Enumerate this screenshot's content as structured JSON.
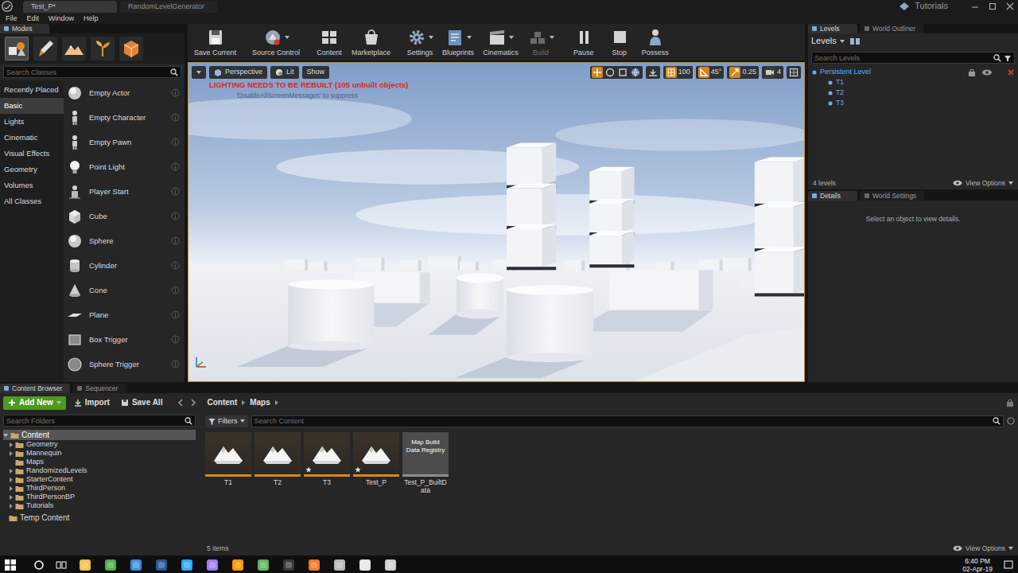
{
  "titlebar": {
    "tabs": [
      {
        "label": "Test_P*",
        "selected": true
      },
      {
        "label": "RandomLevelGenerator",
        "selected": false
      }
    ],
    "tutorials": "Tutorials"
  },
  "menu": [
    "File",
    "Edit",
    "Window",
    "Help"
  ],
  "modes": {
    "tabs": [
      {
        "label": "Modes",
        "selected": true
      }
    ],
    "tools": [
      {
        "selected": true
      },
      {
        "selected": false
      },
      {
        "selected": false
      },
      {
        "selected": false
      },
      {
        "selected": false
      }
    ],
    "search": {
      "placeholder": "Search Classes"
    },
    "categories": [
      {
        "label": "Recently Placed",
        "selected": false
      },
      {
        "label": "Basic",
        "selected": true
      },
      {
        "label": "Lights",
        "selected": false
      },
      {
        "label": "Cinematic",
        "selected": false
      },
      {
        "label": "Visual Effects",
        "selected": false
      },
      {
        "label": "Geometry",
        "selected": false
      },
      {
        "label": "Volumes",
        "selected": false
      },
      {
        "label": "All Classes",
        "selected": false
      }
    ],
    "items": [
      "Empty Actor",
      "Empty Character",
      "Empty Pawn",
      "Point Light",
      "Player Start",
      "Cube",
      "Sphere",
      "Cylinder",
      "Cone",
      "Plane",
      "Box Trigger",
      "Sphere Trigger"
    ]
  },
  "toolbar": [
    {
      "label": "Save Current",
      "dropdown": false,
      "disabled": false
    },
    {
      "label": "Source Control",
      "dropdown": true,
      "disabled": false
    },
    {
      "label": "Content",
      "dropdown": false,
      "disabled": false
    },
    {
      "label": "Marketplace",
      "dropdown": false,
      "disabled": false
    },
    {
      "label": "Settings",
      "dropdown": true,
      "disabled": false
    },
    {
      "label": "Blueprints",
      "dropdown": true,
      "disabled": false
    },
    {
      "label": "Cinematics",
      "dropdown": true,
      "disabled": false
    },
    {
      "label": "Build",
      "dropdown": true,
      "disabled": true
    },
    {
      "label": "Pause",
      "dropdown": false,
      "disabled": false
    },
    {
      "label": "Stop",
      "dropdown": false,
      "disabled": false
    },
    {
      "label": "Possess",
      "dropdown": false,
      "disabled": false
    }
  ],
  "viewport": {
    "view": "Perspective",
    "lighting": "Lit",
    "show": "Show",
    "warning": "LIGHTING NEEDS TO BE REBUILT (105 unbuilt objects)",
    "hint": "'DisableAllScreenMessages' to suppress",
    "snaps": [
      {
        "value": "100",
        "on": true
      },
      {
        "value": "45°",
        "on": true
      },
      {
        "value": "0.25",
        "on": true
      },
      {
        "value": "4",
        "on": false
      }
    ]
  },
  "levels_panel": {
    "tabs": [
      {
        "label": "Levels",
        "selected": true
      },
      {
        "label": "World Outliner",
        "selected": false
      }
    ],
    "menu": "Levels",
    "search": {
      "placeholder": "Search Levels"
    },
    "levels": [
      {
        "name": "Persistent Level",
        "selected": true
      },
      {
        "name": "T1",
        "selected": false
      },
      {
        "name": "T2",
        "selected": false
      },
      {
        "name": "T3",
        "selected": false
      }
    ],
    "count": "4 levels",
    "view_options": "View Options"
  },
  "details_panel": {
    "tabs": [
      {
        "label": "Details",
        "selected": true
      },
      {
        "label": "World Settings",
        "selected": false
      }
    ],
    "message": "Select an object to view details."
  },
  "content_browser": {
    "tabs": [
      {
        "label": "Content Browser",
        "selected": true
      },
      {
        "label": "Sequencer",
        "selected": false
      }
    ],
    "buttons": [
      "Add New",
      "Import",
      "Save All"
    ],
    "path": [
      "Content",
      "Maps"
    ],
    "folder_search": {
      "placeholder": "Search Folders"
    },
    "folders": [
      {
        "name": "Content",
        "expandable": true,
        "expanded": true,
        "selected": true,
        "children": [
          {
            "name": "Geometry",
            "expandable": true,
            "expanded": false,
            "selected": false
          },
          {
            "name": "Mannequin",
            "expandable": true,
            "expanded": false,
            "selected": false
          },
          {
            "name": "Maps",
            "expandable": false,
            "expanded": false,
            "selected": false
          },
          {
            "name": "RandomizedLevels",
            "expandable": true,
            "expanded": false,
            "selected": false
          },
          {
            "name": "StarterContent",
            "expandable": true,
            "expanded": false,
            "selected": false
          },
          {
            "name": "ThirdPerson",
            "expandable": true,
            "expanded": false,
            "selected": false
          },
          {
            "name": "ThirdPersonBP",
            "expandable": true,
            "expanded": false,
            "selected": false
          },
          {
            "name": "Tutorials",
            "expandable": true,
            "expanded": false,
            "selected": false
          }
        ]
      },
      {
        "name": "Temp Content",
        "expandable": false,
        "expanded": false,
        "selected": false,
        "children": []
      }
    ],
    "filters": "Filters",
    "search": {
      "placeholder": "Search Content"
    },
    "assets": [
      {
        "name": "T1",
        "kind": "map",
        "modified": false
      },
      {
        "name": "T2",
        "kind": "map",
        "modified": false
      },
      {
        "name": "T3",
        "kind": "map",
        "modified": true
      },
      {
        "name": "Test_P",
        "kind": "map",
        "modified": true
      },
      {
        "name": "Test_P_BuiltData",
        "kind": "registry",
        "type_label": "Map Build Data Registry",
        "modified": false
      }
    ],
    "count": "5 items",
    "view_options": "View Options"
  },
  "taskbar": {
    "apps": [
      {
        "color": "#f2c14e",
        "active": false
      },
      {
        "color": "#4caf50",
        "active": false
      },
      {
        "color": "#3d8fd8",
        "active": false
      },
      {
        "color": "#2b5797",
        "active": false
      },
      {
        "color": "#31a8ff",
        "active": false
      },
      {
        "color": "#9b7bff",
        "active": false
      },
      {
        "color": "#ff9a00",
        "active": false
      },
      {
        "color": "#5fb85f",
        "active": false
      },
      {
        "color": "#3a3a3a",
        "active": false
      },
      {
        "color": "#f5792a",
        "active": false
      },
      {
        "color": "#b8b8b8",
        "active": false
      },
      {
        "color": "#e6e6e6",
        "active": true
      },
      {
        "color": "#cfcfcf",
        "active": false
      }
    ],
    "time": "6:40 PM",
    "date": "02-Apr-19"
  }
}
